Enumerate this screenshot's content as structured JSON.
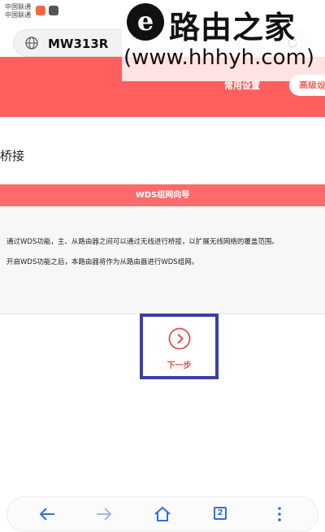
{
  "status_bar": {
    "carrier_1": "中国联通",
    "carrier_2": "中国联通"
  },
  "address_bar": {
    "url": "MW313R"
  },
  "watermark": {
    "title": "路由之家",
    "url": "(www.hhhyh.com)"
  },
  "nav": {
    "common_settings": "常用设置",
    "advanced_settings": "高级设"
  },
  "page": {
    "section_title": "桥接",
    "wizard_header": "WDS组网向导",
    "paragraph_1": "通过WDS功能，主、从路由器之间可以通过无线进行桥接，以扩展无线网络的覆盖范围。",
    "paragraph_2": "开启WDS功能之后，本路由器将作为从路由器进行WDS组网。",
    "next_step": "下一步"
  },
  "toolbar": {
    "tab_count": "2"
  },
  "colors": {
    "accent_red": "#ff5f5f",
    "highlight_blue": "#3a3fa8",
    "toolbar_blue": "#2f6fd6"
  },
  "icons": [
    "globe-icon",
    "refresh-icon",
    "chevron-right-icon",
    "back-arrow-icon",
    "forward-arrow-icon",
    "home-icon",
    "tabs-icon",
    "more-menu-icon"
  ]
}
